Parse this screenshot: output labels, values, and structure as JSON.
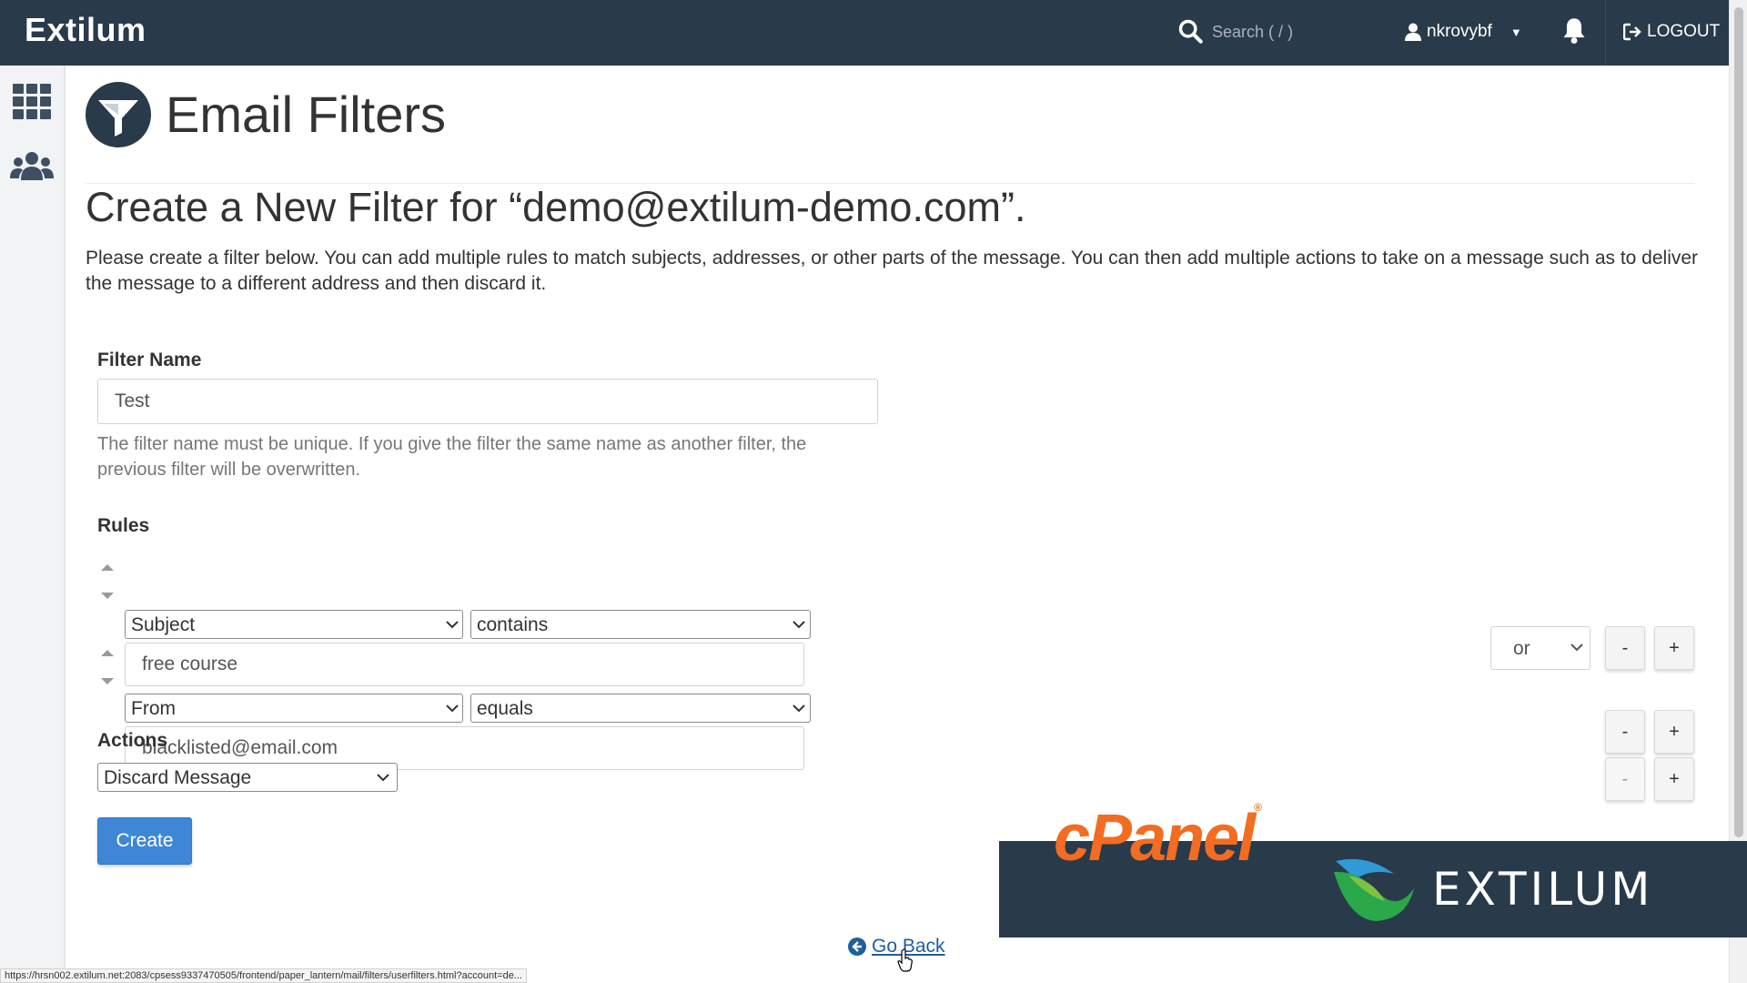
{
  "topbar": {
    "brand": "Extilum",
    "search_placeholder": "Search ( / )",
    "username": "nkrovybf",
    "logout_label": "LOGOUT"
  },
  "sidebar": {
    "items": [
      {
        "icon": "grid-icon"
      },
      {
        "icon": "users-icon"
      }
    ]
  },
  "page": {
    "title": "Email Filters",
    "subheading": "Create a New Filter for “demo@extilum-demo.com”.",
    "intro": "Please create a filter below. You can add multiple rules to match subjects, addresses, or other parts of the message. You can then add multiple actions to take on a message such as to deliver the message to a different address and then discard it."
  },
  "form": {
    "filter_name_label": "Filter Name",
    "filter_name_value": "Test",
    "filter_name_help": "The filter name must be unique. If you give the filter the same name as another filter, the previous filter will be overwritten.",
    "rules_label": "Rules",
    "rules": [
      {
        "field": "Subject",
        "operator": "contains",
        "value": "free course",
        "join": "or"
      },
      {
        "field": "From",
        "operator": "equals",
        "value": "blacklisted@email.com"
      }
    ],
    "actions_label": "Actions",
    "actions": [
      {
        "action": "Discard Message"
      }
    ],
    "minus_label": "-",
    "plus_label": "+",
    "create_label": "Create"
  },
  "footer": {
    "go_back_label": "Go Back",
    "status_url": "https://hrsn002.extilum.net:2083/cpsess9337470505/frontend/paper_lantern/mail/filters/userfilters.html?account=de..."
  },
  "overlay": {
    "cpanel_text": "cPanel",
    "cpanel_reg": "®",
    "extilum_text": "EXTILUM"
  },
  "colors": {
    "topbar": "#293a4a",
    "primary_button": "#3f87d6",
    "cpanel_orange": "#f26c22",
    "link": "#1f5f9e"
  }
}
